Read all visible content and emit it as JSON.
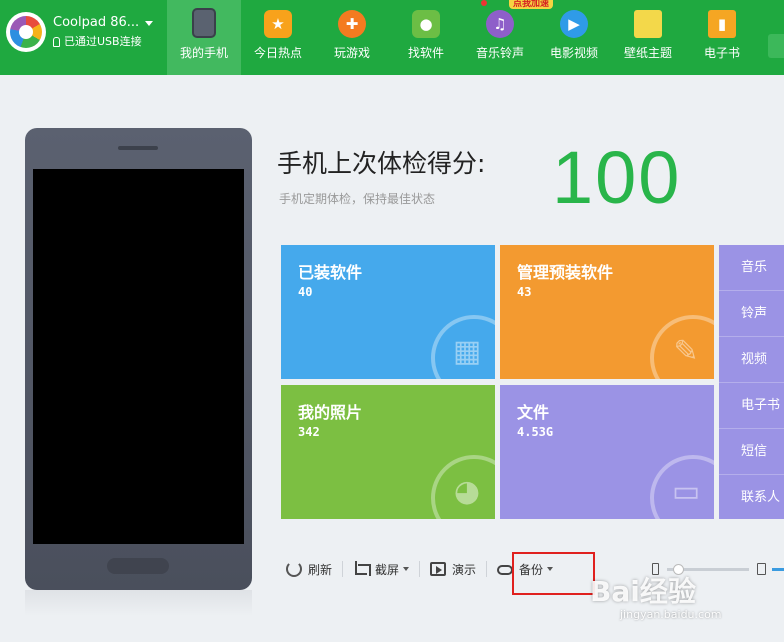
{
  "device": {
    "name": "Coolpad 86...",
    "status": "已通过USB连接"
  },
  "nav": {
    "items": [
      {
        "label": "我的手机",
        "icon": "phone-icon",
        "active": true
      },
      {
        "label": "今日热点",
        "icon": "hot-star-icon"
      },
      {
        "label": "玩游戏",
        "icon": "game-controller-icon"
      },
      {
        "label": "找软件",
        "icon": "android-icon"
      },
      {
        "label": "音乐铃声",
        "icon": "music-note-icon"
      },
      {
        "label": "电影视频",
        "icon": "play-icon"
      },
      {
        "label": "壁纸主题",
        "icon": "wallpaper-icon"
      },
      {
        "label": "电子书",
        "icon": "book-icon"
      }
    ],
    "promo": "点我加速"
  },
  "score": {
    "title": "手机上次体检得分:",
    "subtitle": "手机定期体检，保持最佳状态",
    "value": "100"
  },
  "tiles": {
    "installed": {
      "label": "已装软件",
      "value": "40"
    },
    "preinstalled": {
      "label": "管理预装软件",
      "value": "43"
    },
    "photos": {
      "label": "我的照片",
      "value": "342"
    },
    "files": {
      "label": "文件",
      "value": "4.53G"
    }
  },
  "side_list": [
    "音乐",
    "铃声",
    "视频",
    "电子书",
    "短信",
    "联系人"
  ],
  "toolbar": {
    "refresh": "刷新",
    "screenshot": "截屏",
    "present": "演示",
    "backup": "备份"
  },
  "watermark": {
    "brand": "Bai经验",
    "url": "jingyan.baidu.com"
  },
  "colors": {
    "topbar": "#1fa940",
    "score": "#29b54a",
    "tile_blue": "#45a9ec",
    "tile_orange": "#f39a30",
    "tile_green": "#7cbf42",
    "tile_purple": "#9b93e5",
    "highlight": "#e0201e"
  }
}
